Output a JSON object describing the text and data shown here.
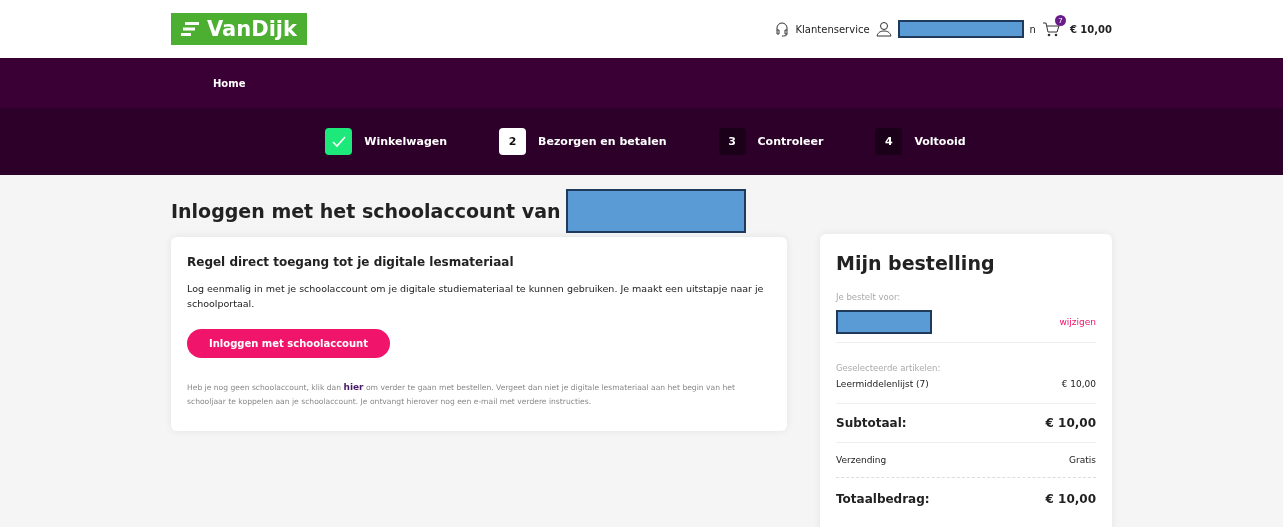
{
  "header": {
    "logo": "VanDijk",
    "service": "Klantenservice",
    "user_name_tail": "n",
    "cart_count": "7",
    "cart_total": "€ 10,00"
  },
  "nav": {
    "items": [
      "Home"
    ]
  },
  "steps": [
    {
      "label": "Winkelwagen",
      "kind": "done"
    },
    {
      "number": "2",
      "label": "Bezorgen en betalen",
      "kind": "current"
    },
    {
      "number": "3",
      "label": "Controleer",
      "kind": "upcoming"
    },
    {
      "number": "4",
      "label": "Voltooid",
      "kind": "upcoming"
    }
  ],
  "page_title": "Inloggen met het schoolaccount van",
  "login_card": {
    "title": "Regel direct toegang tot je digitale lesmateriaal",
    "text": "Log eenmalig in met je schoolaccount om je digitale studiemateriaal te kunnen gebruiken. Je maakt een uitstapje naar je schoolportaal.",
    "button": "Inloggen met schoolaccount",
    "note_before": "Heb je nog geen schoolaccount, klik dan",
    "note_link": "hier",
    "note_after": "om verder te gaan met bestellen. Vergeet dan niet je digitale lesmateriaal aan het begin van het schooljaar te koppelen aan je schoolaccount. Je ontvangt hierover nog een e-mail met verdere instructies."
  },
  "order": {
    "title": "Mijn bestelling",
    "for_label": "Je bestelt voor:",
    "change_link": "wijzigen",
    "items_label": "Geselecteerde artikelen:",
    "items": [
      {
        "name": "Leermiddelenlijst (7)",
        "price": "€ 10,00"
      }
    ],
    "subtotal_label": "Subtotaal:",
    "subtotal": "€ 10,00",
    "shipping_label": "Verzending",
    "shipping": "Gratis",
    "total_label": "Totaalbedrag:",
    "total": "€ 10,00"
  }
}
